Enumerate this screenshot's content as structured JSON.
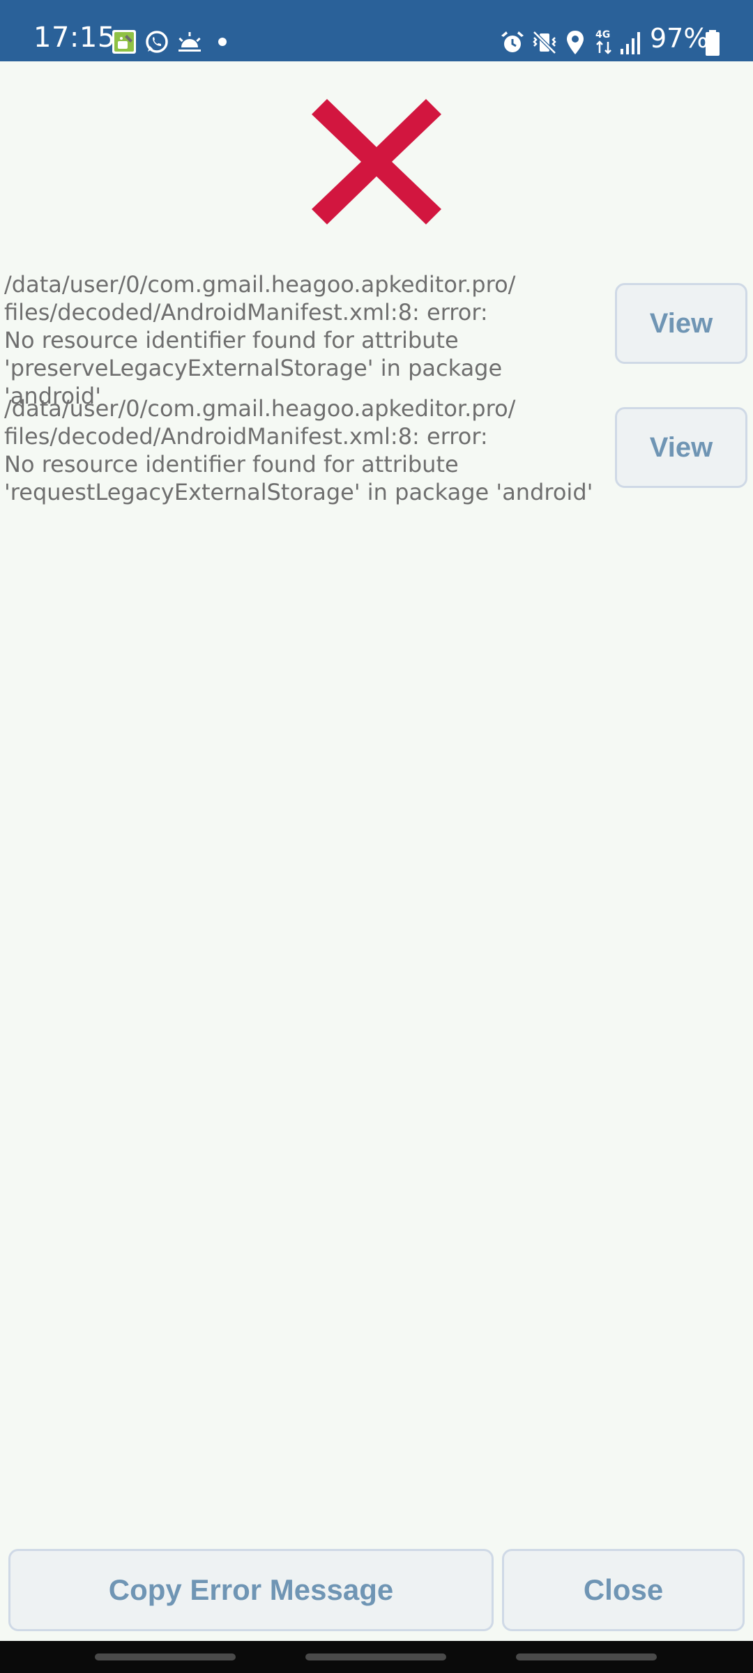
{
  "status_bar": {
    "time": "17:15",
    "battery": "97%",
    "left_icons": [
      "apk-editor-icon",
      "whatsapp-icon",
      "sunrise-icon",
      "dot-icon"
    ],
    "right_icons": [
      "alarm-icon",
      "vibrate-off-icon",
      "location-icon",
      "4g-icon",
      "signal-icon",
      "battery-icon"
    ],
    "background_color": "#2a6199"
  },
  "error_icon": {
    "name": "red-x-icon",
    "color": "#d2163f"
  },
  "errors": [
    {
      "message": "/data/user/0/com.gmail.heagoo.apkeditor.pro/\nfiles/decoded/AndroidManifest.xml:8: error:\nNo resource identifier found for attribute\n'preserveLegacyExternalStorage' in package 'android'",
      "button_label": "View"
    },
    {
      "message": "/data/user/0/com.gmail.heagoo.apkeditor.pro/\nfiles/decoded/AndroidManifest.xml:8: error:\nNo resource identifier found for attribute\n'requestLegacyExternalStorage' in package 'android'",
      "button_label": "View"
    }
  ],
  "actions": {
    "copy_label": "Copy Error Message",
    "close_label": "Close"
  },
  "colors": {
    "background": "#f5f9f4",
    "button_text": "#6f95b4",
    "error_text": "#6e6e6e"
  }
}
